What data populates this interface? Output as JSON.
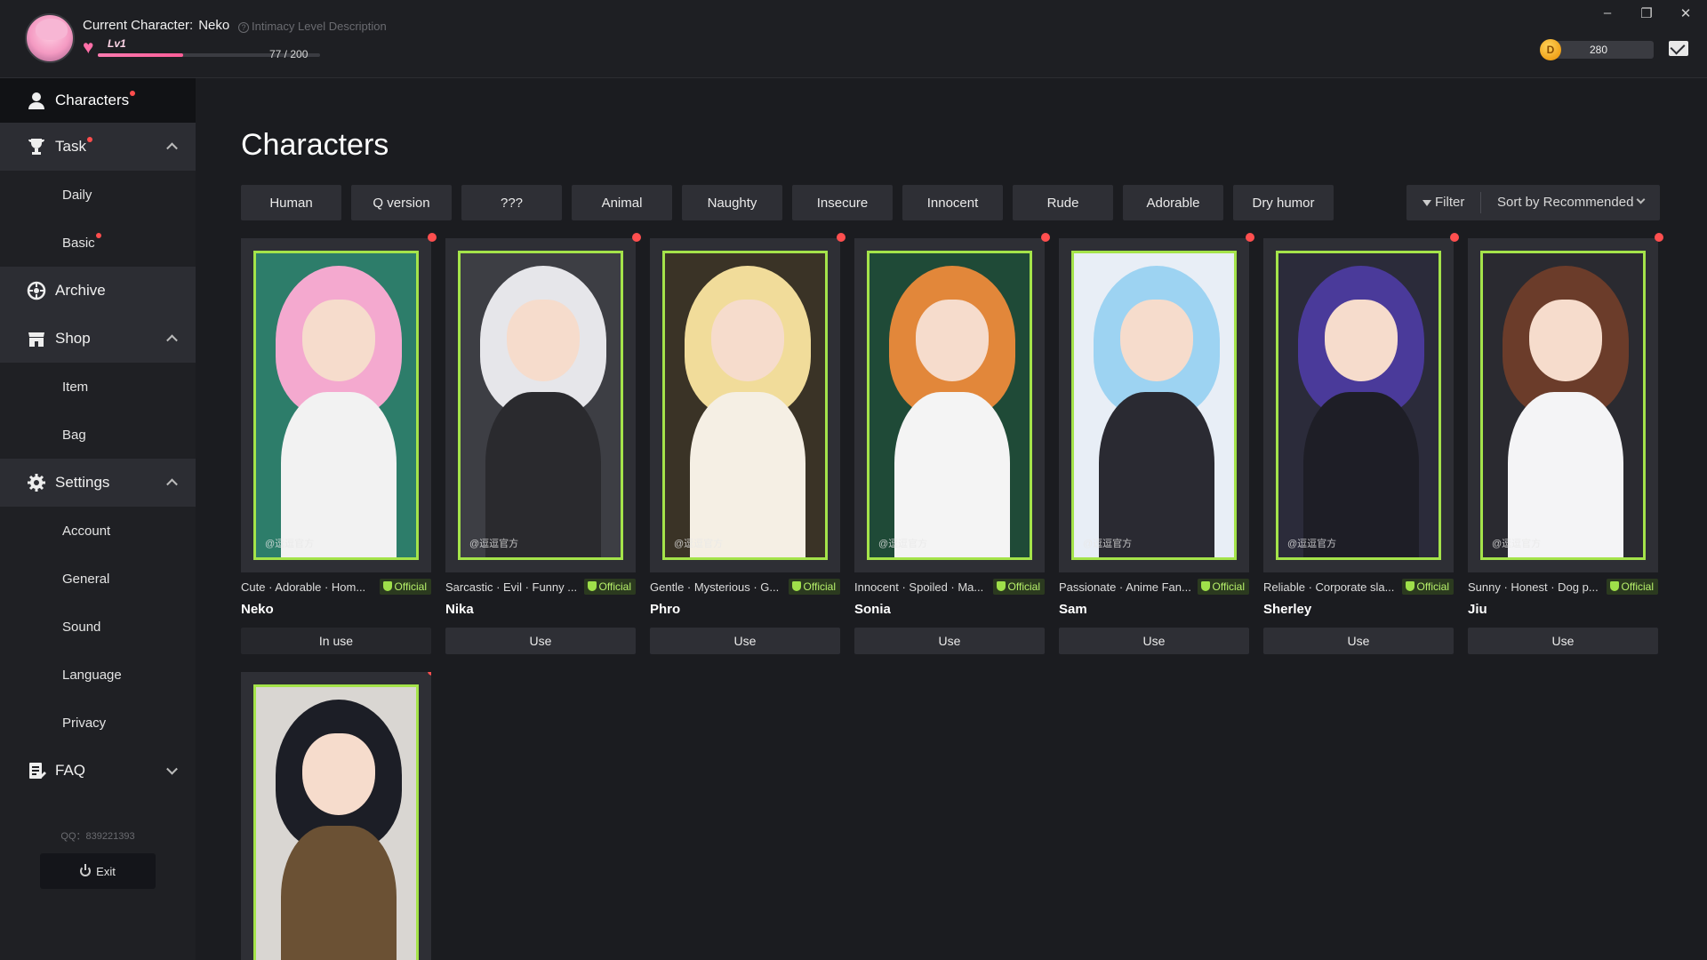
{
  "window": {
    "minimize": "–",
    "restore": "❐",
    "close": "✕"
  },
  "header": {
    "current_character_label": "Current Character:",
    "current_character_name": "Neko",
    "intimacy_link": "Intimacy Level Description",
    "level": "Lv1",
    "xp_text": "77 / 200",
    "xp_fraction": 0.385,
    "coins": "280"
  },
  "sidebar": {
    "top_item": "Characters",
    "task": {
      "label": "Task",
      "items": [
        "Daily",
        "Basic"
      ]
    },
    "archive": "Archive",
    "shop": {
      "label": "Shop",
      "items": [
        "Item",
        "Bag"
      ]
    },
    "settings": {
      "label": "Settings",
      "items": [
        "Account",
        "General",
        "Sound",
        "Language",
        "Privacy"
      ]
    },
    "faq": "FAQ",
    "qq": "QQ：839221393",
    "exit": "Exit"
  },
  "main": {
    "title": "Characters",
    "tags": [
      "Human",
      "Q version",
      "???",
      "Animal",
      "Naughty",
      "Insecure",
      "Innocent",
      "Rude",
      "Adorable",
      "Dry humor"
    ],
    "filter_label": "Filter",
    "sort_label": "Sort by Recommended"
  },
  "watermark": "@逗逗官方",
  "official_label": "Official",
  "characters": [
    {
      "name": "Neko",
      "tags": "Cute · Adorable · Hom...",
      "button": "In use",
      "hair": "#f4a9cf",
      "body": "#f2f2f2",
      "bg": "#2d7d6a"
    },
    {
      "name": "Nika",
      "tags": "Sarcastic · Evil · Funny ...",
      "button": "Use",
      "hair": "#e6e6ea",
      "body": "#2a2a2e",
      "bg": "#3d3e44"
    },
    {
      "name": "Phro",
      "tags": "Gentle · Mysterious · G...",
      "button": "Use",
      "hair": "#f1dc9a",
      "body": "#f5efe4",
      "bg": "#3a3326"
    },
    {
      "name": "Sonia",
      "tags": "Innocent · Spoiled · Ma...",
      "button": "Use",
      "hair": "#e2873a",
      "body": "#f4f4f4",
      "bg": "#1f4a37"
    },
    {
      "name": "Sam",
      "tags": "Passionate · Anime Fan...",
      "button": "Use",
      "hair": "#9dd3f2",
      "body": "#2a2a32",
      "bg": "#e8eef6"
    },
    {
      "name": "Sherley",
      "tags": "Reliable · Corporate sla...",
      "button": "Use",
      "hair": "#4a3a9a",
      "body": "#1e1e26",
      "bg": "#2b2b3a"
    },
    {
      "name": "Jiu",
      "tags": "Sunny · Honest · Dog p...",
      "button": "Use",
      "hair": "#6b3c2a",
      "body": "#f4f4f6",
      "bg": "#2a2a30"
    },
    {
      "name": "",
      "tags": "",
      "button": "",
      "hair": "#1c1e26",
      "body": "#6b5134",
      "bg": "#d9d6d2"
    }
  ]
}
